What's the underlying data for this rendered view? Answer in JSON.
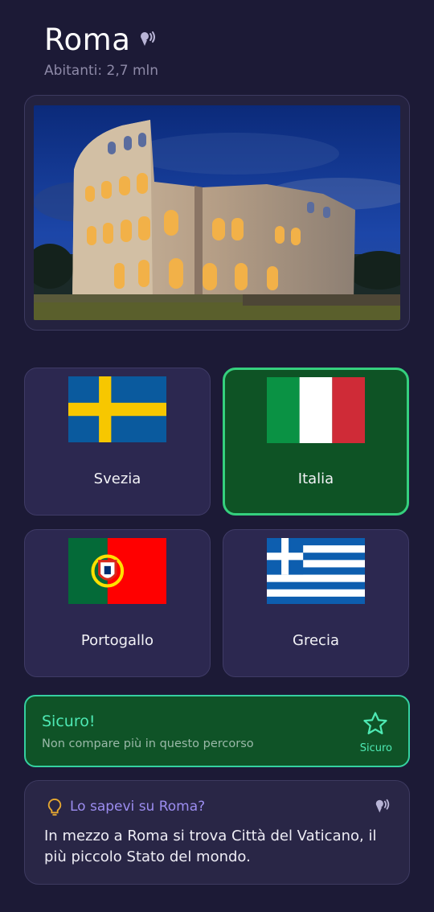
{
  "city": {
    "name": "Roma",
    "population": "Abitanti: 2,7 mln",
    "speak_icon": "speaker-voice-icon"
  },
  "photo": {
    "subject": "colosseum-photo"
  },
  "options": [
    {
      "label": "Svezia",
      "flag": "sweden-flag",
      "state": "default"
    },
    {
      "label": "Italia",
      "flag": "italy-flag",
      "state": "correct"
    },
    {
      "label": "Portogallo",
      "flag": "portugal-flag",
      "state": "default"
    },
    {
      "label": "Grecia",
      "flag": "greece-flag",
      "state": "default"
    }
  ],
  "mastered": {
    "title": "Sicuro!",
    "subtitle": "Non compare più in questo percorso",
    "star_label": "Sicuro",
    "star_icon": "star-outline-icon"
  },
  "fact": {
    "title": "Lo sapevi su Roma?",
    "text": "In mezzo a Roma si trova Città del Vaticano, il più piccolo Stato del mondo.",
    "bulb_icon": "lightbulb-icon",
    "speak_icon": "speaker-voice-icon"
  },
  "colors": {
    "background": "#1c1a36",
    "card": "#2c2850",
    "correct_bg": "#0e5325",
    "correct_border": "#35d07e",
    "accent_teal": "#4ee9b4",
    "accent_purple": "#9c8df0"
  }
}
